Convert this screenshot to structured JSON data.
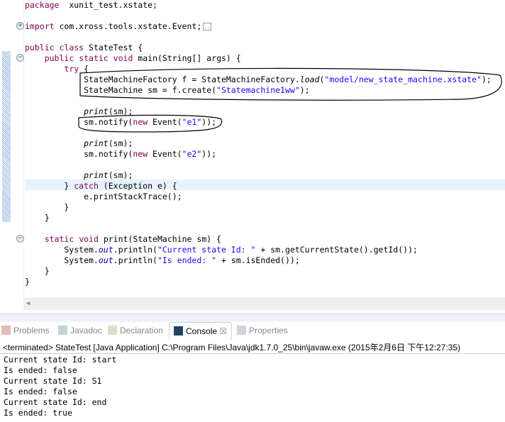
{
  "editor": {
    "lines": [
      {
        "row": 0,
        "tokens": [
          [
            "kw",
            "package"
          ],
          [
            "",
            "  xunit_test.xstate;"
          ]
        ]
      },
      {
        "row": 2,
        "tokens": [
          [
            "kw",
            "import"
          ],
          [
            "",
            " com.xross.tools.xstate.Event;"
          ]
        ],
        "collapsed_marker": ".."
      },
      {
        "row": 4,
        "tokens": [
          [
            "kw",
            "public"
          ],
          [
            "",
            " "
          ],
          [
            "kw",
            "class"
          ],
          [
            "",
            " StateTest {"
          ]
        ]
      },
      {
        "row": 5,
        "tokens": [
          [
            "",
            "    "
          ],
          [
            "kw",
            "public"
          ],
          [
            "",
            " "
          ],
          [
            "kw",
            "static"
          ],
          [
            "",
            " "
          ],
          [
            "kw",
            "void"
          ],
          [
            "",
            " main(String[] args) {"
          ]
        ]
      },
      {
        "row": 6,
        "tokens": [
          [
            "",
            "        "
          ],
          [
            "kw",
            "try"
          ],
          [
            "",
            " {"
          ]
        ]
      },
      {
        "row": 7,
        "tokens": [
          [
            "",
            "            StateMachineFactory f = StateMachineFactory."
          ],
          [
            "it",
            "load"
          ],
          [
            "",
            "("
          ],
          [
            "str",
            "\"model/new_state_machine.xstate\""
          ],
          [
            "",
            ");"
          ]
        ]
      },
      {
        "row": 8,
        "tokens": [
          [
            "",
            "            StateMachine sm = f.create("
          ],
          [
            "str",
            "\"Statemachine1ww\""
          ],
          [
            "",
            ");"
          ]
        ]
      },
      {
        "row": 10,
        "tokens": [
          [
            "",
            "            "
          ],
          [
            "it",
            "print"
          ],
          [
            "",
            "(sm);"
          ]
        ]
      },
      {
        "row": 11,
        "tokens": [
          [
            "",
            "            sm.notify("
          ],
          [
            "kw",
            "new"
          ],
          [
            "",
            " Event("
          ],
          [
            "str",
            "\"e1\""
          ],
          [
            "",
            "));"
          ]
        ]
      },
      {
        "row": 13,
        "tokens": [
          [
            "",
            "            "
          ],
          [
            "it",
            "print"
          ],
          [
            "",
            "(sm);"
          ]
        ]
      },
      {
        "row": 14,
        "tokens": [
          [
            "",
            "            sm.notify("
          ],
          [
            "kw",
            "new"
          ],
          [
            "",
            " Event("
          ],
          [
            "str",
            "\"e2\""
          ],
          [
            "",
            "));"
          ]
        ]
      },
      {
        "row": 16,
        "tokens": [
          [
            "",
            "            "
          ],
          [
            "it",
            "print"
          ],
          [
            "",
            "(sm);"
          ]
        ]
      },
      {
        "row": 17,
        "tokens": [
          [
            "",
            "        } "
          ],
          [
            "kw",
            "catch"
          ],
          [
            "",
            " (Exception e) {"
          ]
        ]
      },
      {
        "row": 18,
        "tokens": [
          [
            "",
            "            e.printStackTrace();"
          ]
        ]
      },
      {
        "row": 19,
        "tokens": [
          [
            "",
            "        }"
          ]
        ]
      },
      {
        "row": 20,
        "tokens": [
          [
            "",
            "    }"
          ]
        ]
      },
      {
        "row": 22,
        "tokens": [
          [
            "",
            "    "
          ],
          [
            "kw",
            "static"
          ],
          [
            "",
            " "
          ],
          [
            "kw",
            "void"
          ],
          [
            "",
            " print(StateMachine sm) {"
          ]
        ]
      },
      {
        "row": 23,
        "tokens": [
          [
            "",
            "        System."
          ],
          [
            "st",
            "out"
          ],
          [
            "",
            ".println("
          ],
          [
            "str",
            "\"Current state Id: \""
          ],
          [
            "",
            " + sm.getCurrentState().getId());"
          ]
        ]
      },
      {
        "row": 24,
        "tokens": [
          [
            "",
            "        System."
          ],
          [
            "st",
            "out"
          ],
          [
            "",
            ".println("
          ],
          [
            "str",
            "\"Is ended: \""
          ],
          [
            "",
            " + sm.isEnded());"
          ]
        ]
      },
      {
        "row": 25,
        "tokens": [
          [
            "",
            "    }"
          ]
        ]
      },
      {
        "row": 26,
        "tokens": [
          [
            "",
            "}"
          ]
        ]
      }
    ],
    "current_line_row": 17
  },
  "views": {
    "tabs": [
      {
        "label": "Problems",
        "icon": "problems-icon",
        "active": false
      },
      {
        "label": "Javadoc",
        "icon": "at-icon",
        "active": false
      },
      {
        "label": "Declaration",
        "icon": "declaration-icon",
        "active": false
      },
      {
        "label": "Console",
        "icon": "console-icon",
        "active": true
      },
      {
        "label": "Properties",
        "icon": "properties-icon",
        "active": false
      }
    ],
    "console_header": "<terminated> StateTest [Java Application] C:\\Program Files\\Java\\jdk1.7.0_25\\bin\\javaw.exe (2015年2月6日 下午12:27:35)",
    "output": [
      "Current state Id: start",
      "Is ended: false",
      "Current state Id: S1",
      "Is ended: false",
      "Current state Id: end",
      "Is ended: true"
    ]
  },
  "colors": {
    "keyword": "#7f0055",
    "string": "#2a00ff",
    "static_field": "#0000c0",
    "current_line": "#e8f2fe"
  }
}
